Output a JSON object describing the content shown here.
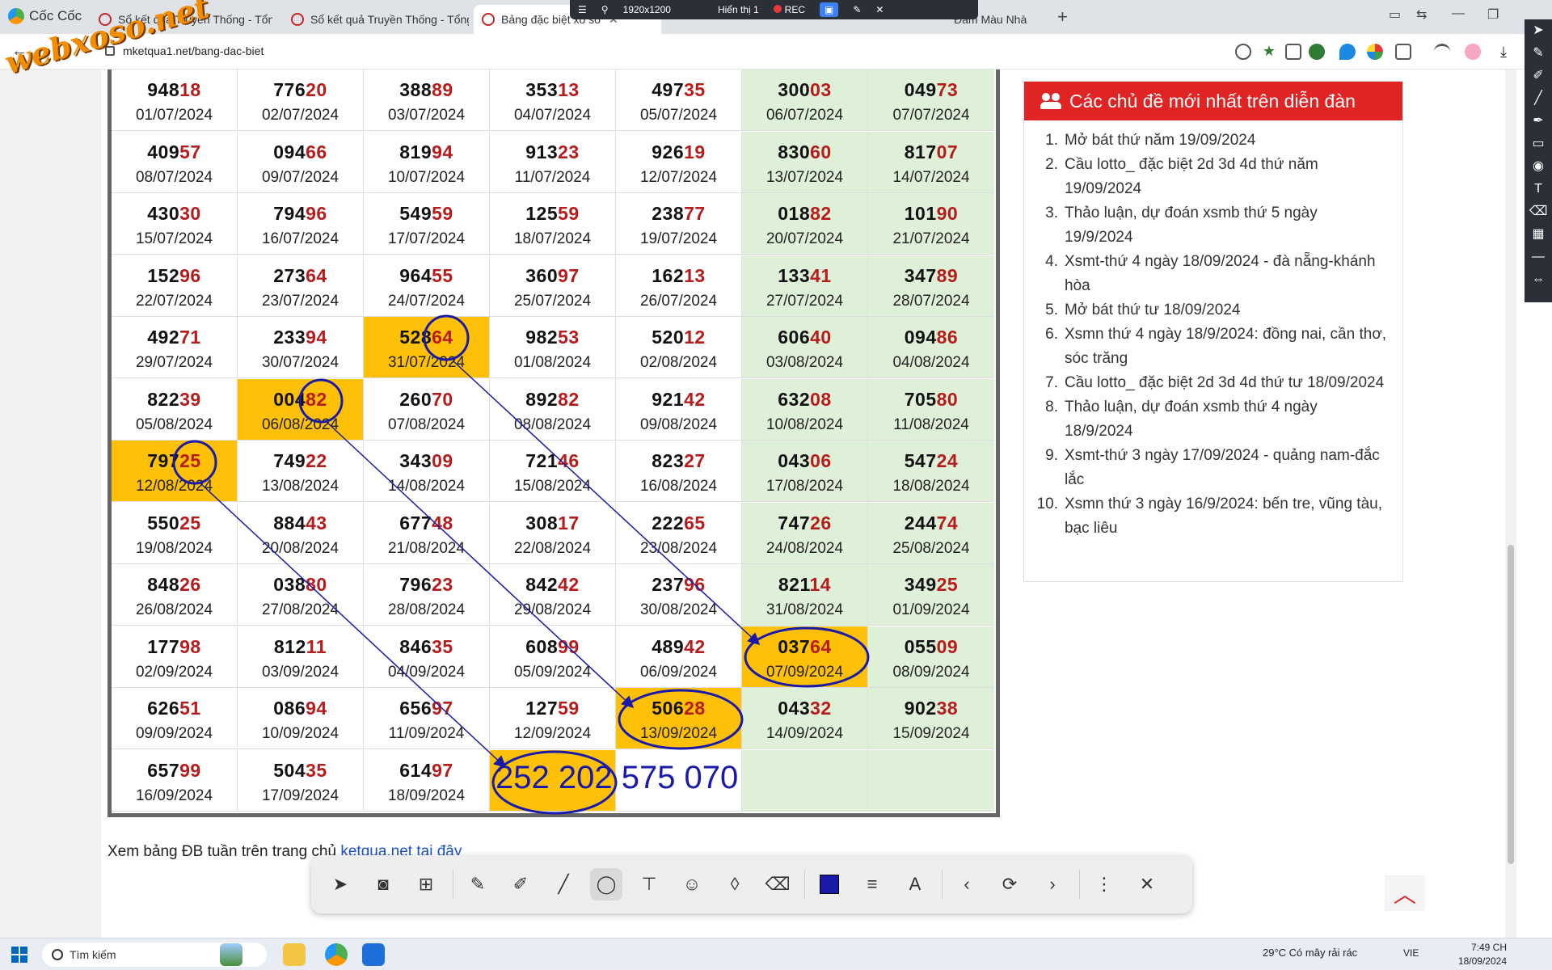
{
  "browser": {
    "brand": "Cốc Cốc",
    "tabs": [
      {
        "label": "Sổ kết quả Truyền Thống - Tổng h",
        "active": false
      },
      {
        "label": "Sổ kết quả Truyền Thống - Tổng h",
        "active": false
      },
      {
        "label": "Bảng đặc biệt xổ số",
        "active": true
      },
      {
        "label": "Đàm Màu Nhà",
        "active": false
      }
    ],
    "url": "mketqua1.net/bang-dac-biet"
  },
  "recorder": {
    "resolution": "1920x1200",
    "display": "Hiển thị 1",
    "rec_label": "REC"
  },
  "watermark": "webxoso.net",
  "grid": {
    "rows": [
      [
        {
          "n": "948",
          "t": "18",
          "d": "01/07/2024"
        },
        {
          "n": "776",
          "t": "20",
          "d": "02/07/2024"
        },
        {
          "n": "388",
          "t": "89",
          "d": "03/07/2024"
        },
        {
          "n": "353",
          "t": "13",
          "d": "04/07/2024"
        },
        {
          "n": "497",
          "t": "35",
          "d": "05/07/2024"
        },
        {
          "n": "300",
          "t": "03",
          "d": "06/07/2024"
        },
        {
          "n": "049",
          "t": "73",
          "d": "07/07/2024"
        }
      ],
      [
        {
          "n": "409",
          "t": "57",
          "d": "08/07/2024"
        },
        {
          "n": "094",
          "t": "66",
          "d": "09/07/2024"
        },
        {
          "n": "819",
          "t": "94",
          "d": "10/07/2024"
        },
        {
          "n": "913",
          "t": "23",
          "d": "11/07/2024"
        },
        {
          "n": "926",
          "t": "19",
          "d": "12/07/2024"
        },
        {
          "n": "830",
          "t": "60",
          "d": "13/07/2024"
        },
        {
          "n": "817",
          "t": "07",
          "d": "14/07/2024"
        }
      ],
      [
        {
          "n": "430",
          "t": "30",
          "d": "15/07/2024"
        },
        {
          "n": "794",
          "t": "96",
          "d": "16/07/2024"
        },
        {
          "n": "549",
          "t": "59",
          "d": "17/07/2024"
        },
        {
          "n": "125",
          "t": "59",
          "d": "18/07/2024"
        },
        {
          "n": "238",
          "t": "77",
          "d": "19/07/2024"
        },
        {
          "n": "018",
          "t": "82",
          "d": "20/07/2024"
        },
        {
          "n": "101",
          "t": "90",
          "d": "21/07/2024"
        }
      ],
      [
        {
          "n": "152",
          "t": "96",
          "d": "22/07/2024"
        },
        {
          "n": "273",
          "t": "64",
          "d": "23/07/2024"
        },
        {
          "n": "964",
          "t": "55",
          "d": "24/07/2024"
        },
        {
          "n": "360",
          "t": "97",
          "d": "25/07/2024"
        },
        {
          "n": "162",
          "t": "13",
          "d": "26/07/2024"
        },
        {
          "n": "133",
          "t": "41",
          "d": "27/07/2024"
        },
        {
          "n": "347",
          "t": "89",
          "d": "28/07/2024"
        }
      ],
      [
        {
          "n": "492",
          "t": "71",
          "d": "29/07/2024"
        },
        {
          "n": "233",
          "t": "94",
          "d": "30/07/2024"
        },
        {
          "n": "528",
          "t": "64",
          "d": "31/07/2024",
          "hl": true
        },
        {
          "n": "982",
          "t": "53",
          "d": "01/08/2024"
        },
        {
          "n": "520",
          "t": "12",
          "d": "02/08/2024"
        },
        {
          "n": "606",
          "t": "40",
          "d": "03/08/2024"
        },
        {
          "n": "094",
          "t": "86",
          "d": "04/08/2024"
        }
      ],
      [
        {
          "n": "822",
          "t": "39",
          "d": "05/08/2024"
        },
        {
          "n": "004",
          "t": "82",
          "d": "06/08/2024",
          "hl": true
        },
        {
          "n": "260",
          "t": "70",
          "d": "07/08/2024"
        },
        {
          "n": "892",
          "t": "82",
          "d": "08/08/2024"
        },
        {
          "n": "921",
          "t": "42",
          "d": "09/08/2024"
        },
        {
          "n": "632",
          "t": "08",
          "d": "10/08/2024"
        },
        {
          "n": "705",
          "t": "80",
          "d": "11/08/2024"
        }
      ],
      [
        {
          "n": "797",
          "t": "25",
          "d": "12/08/2024",
          "hl": true
        },
        {
          "n": "749",
          "t": "22",
          "d": "13/08/2024"
        },
        {
          "n": "343",
          "t": "09",
          "d": "14/08/2024"
        },
        {
          "n": "721",
          "t": "46",
          "d": "15/08/2024"
        },
        {
          "n": "823",
          "t": "27",
          "d": "16/08/2024"
        },
        {
          "n": "043",
          "t": "06",
          "d": "17/08/2024"
        },
        {
          "n": "547",
          "t": "24",
          "d": "18/08/2024"
        }
      ],
      [
        {
          "n": "550",
          "t": "25",
          "d": "19/08/2024"
        },
        {
          "n": "884",
          "t": "43",
          "d": "20/08/2024"
        },
        {
          "n": "677",
          "t": "48",
          "d": "21/08/2024"
        },
        {
          "n": "308",
          "t": "17",
          "d": "22/08/2024"
        },
        {
          "n": "222",
          "t": "65",
          "d": "23/08/2024"
        },
        {
          "n": "747",
          "t": "26",
          "d": "24/08/2024"
        },
        {
          "n": "244",
          "t": "74",
          "d": "25/08/2024"
        }
      ],
      [
        {
          "n": "848",
          "t": "26",
          "d": "26/08/2024"
        },
        {
          "n": "038",
          "t": "80",
          "d": "27/08/2024"
        },
        {
          "n": "796",
          "t": "23",
          "d": "28/08/2024"
        },
        {
          "n": "842",
          "t": "42",
          "d": "29/08/2024"
        },
        {
          "n": "237",
          "t": "96",
          "d": "30/08/2024"
        },
        {
          "n": "821",
          "t": "14",
          "d": "31/08/2024"
        },
        {
          "n": "349",
          "t": "25",
          "d": "01/09/2024"
        }
      ],
      [
        {
          "n": "177",
          "t": "98",
          "d": "02/09/2024"
        },
        {
          "n": "812",
          "t": "11",
          "d": "03/09/2024"
        },
        {
          "n": "846",
          "t": "35",
          "d": "04/09/2024"
        },
        {
          "n": "608",
          "t": "99",
          "d": "05/09/2024"
        },
        {
          "n": "489",
          "t": "42",
          "d": "06/09/2024"
        },
        {
          "n": "037",
          "t": "64",
          "d": "07/09/2024",
          "hl": true
        },
        {
          "n": "055",
          "t": "09",
          "d": "08/09/2024"
        }
      ],
      [
        {
          "n": "626",
          "t": "51",
          "d": "09/09/2024"
        },
        {
          "n": "086",
          "t": "94",
          "d": "10/09/2024"
        },
        {
          "n": "656",
          "t": "97",
          "d": "11/09/2024"
        },
        {
          "n": "127",
          "t": "59",
          "d": "12/09/2024"
        },
        {
          "n": "506",
          "t": "28",
          "d": "13/09/2024",
          "hl": true
        },
        {
          "n": "043",
          "t": "32",
          "d": "14/09/2024"
        },
        {
          "n": "902",
          "t": "38",
          "d": "15/09/2024"
        }
      ],
      [
        {
          "n": "657",
          "t": "99",
          "d": "16/09/2024"
        },
        {
          "n": "504",
          "t": "35",
          "d": "17/09/2024"
        },
        {
          "n": "614",
          "t": "97",
          "d": "18/09/2024"
        },
        {
          "n": "",
          "t": "",
          "d": "",
          "hl": true
        },
        {
          "n": "",
          "t": "",
          "d": ""
        },
        {
          "n": "",
          "t": "",
          "d": ""
        },
        {
          "n": "",
          "t": "",
          "d": ""
        }
      ]
    ],
    "annotation_text": "252 202 575 070"
  },
  "forum": {
    "title": "Các chủ đề mới nhất trên diễn đàn",
    "items": [
      {
        "n": "1.",
        "text": "Mở bát thứ năm 19/09/2024"
      },
      {
        "n": "2.",
        "text": "Cầu lotto_ đặc biệt 2d 3d 4d thứ năm 19/09/2024"
      },
      {
        "n": "3.",
        "text": "Thảo luận, dự đoán xsmb thứ 5 ngày 19/9/2024"
      },
      {
        "n": "4.",
        "text": "Xsmt-thứ 4 ngày 18/09/2024 - đà nẵng-khánh hòa"
      },
      {
        "n": "5.",
        "text": "Mở bát thứ tư 18/09/2024"
      },
      {
        "n": "6.",
        "text": "Xsmn thứ 4 ngày 18/9/2024: đồng nai, cần thơ, sóc trăng"
      },
      {
        "n": "7.",
        "text": "Cầu lotto_ đặc biệt 2d 3d 4d thứ tư 18/09/2024"
      },
      {
        "n": "8.",
        "text": "Thảo luận, dự đoán xsmb thứ 4 ngày 18/9/2024"
      },
      {
        "n": "9.",
        "text": "Xsmt-thứ 3 ngày 17/09/2024 - quảng nam-đắc lắc"
      },
      {
        "n": "10.",
        "text": "Xsmn thứ 3 ngày 16/9/2024: bến tre, vũng tàu, bạc liêu"
      }
    ]
  },
  "footer": {
    "text": "Xem bảng ĐB tuần trên trang chủ ",
    "link": "ketqua.net tại đây"
  },
  "taskbar": {
    "search": "Tìm kiếm",
    "weather": "29°C  Có mây rải rác",
    "lang": "VIE",
    "time": "7:49 CH",
    "date": "18/09/2024"
  },
  "colors": {
    "accent_red": "#e02424",
    "highlight": "#ffc107",
    "weekend": "#dff0d8",
    "annotation": "#1a1aa8",
    "tail_digits": "#b71c1c"
  }
}
